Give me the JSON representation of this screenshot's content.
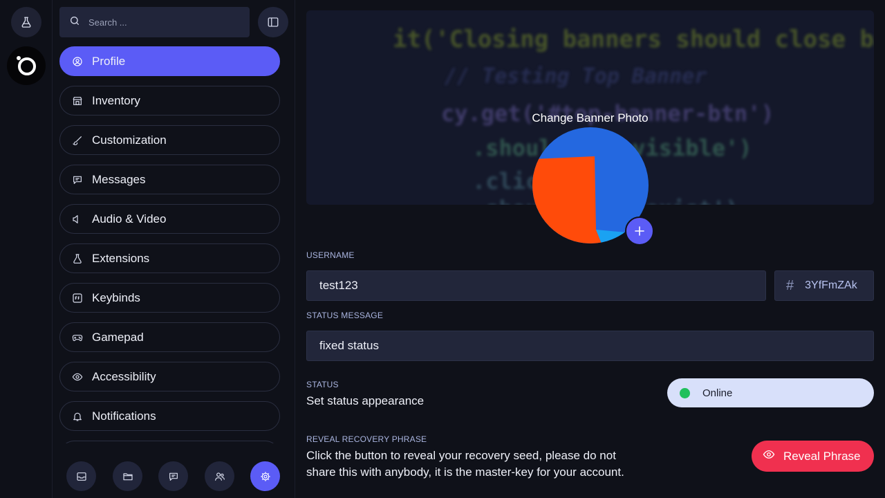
{
  "search": {
    "placeholder": "Search ..."
  },
  "sidebar": {
    "items": [
      {
        "label": "Profile",
        "icon": "user-circle-icon",
        "active": true
      },
      {
        "label": "Inventory",
        "icon": "store-icon"
      },
      {
        "label": "Customization",
        "icon": "brush-icon"
      },
      {
        "label": "Messages",
        "icon": "message-icon"
      },
      {
        "label": "Audio & Video",
        "icon": "speaker-icon"
      },
      {
        "label": "Extensions",
        "icon": "flask-icon"
      },
      {
        "label": "Keybinds",
        "icon": "keyboard-key-icon"
      },
      {
        "label": "Gamepad",
        "icon": "gamepad-icon"
      },
      {
        "label": "Accessibility",
        "icon": "eye-icon"
      },
      {
        "label": "Notifications",
        "icon": "bell-icon"
      }
    ]
  },
  "bottom_bar": {
    "icons": [
      "inbox-icon",
      "folder-icon",
      "chat-icon",
      "friends-icon",
      "settings-icon"
    ],
    "active": "settings-icon"
  },
  "banner": {
    "cta": "Change Banner Photo",
    "code_lines": [
      "it('Closing banners should close banne",
      "// Testing Top Banner",
      "cy.get('#top-banner-btn')",
      ".should('be.visible')",
      ".click()",
      ".should('not.exist')"
    ]
  },
  "profile": {
    "username_label": "USERNAME",
    "username_value": "test123",
    "tag_hash": "#",
    "tag_value": "3YfFmZAk",
    "status_message_label": "STATUS MESSAGE",
    "status_message_value": "fixed status",
    "status_label": "STATUS",
    "status_description": "Set status appearance",
    "status_value": "Online",
    "status_color": "#20c05c",
    "recovery_label": "REVEAL RECOVERY PHRASE",
    "recovery_line1": "Click the button to reveal your recovery seed, please do not",
    "recovery_line2": "share this with anybody, it is the master-key for your account.",
    "reveal_button_label": "Reveal Phrase"
  },
  "colors": {
    "accent": "#5b5cf6",
    "danger": "#f0304f",
    "background": "#0f1119",
    "field": "#22263a"
  }
}
